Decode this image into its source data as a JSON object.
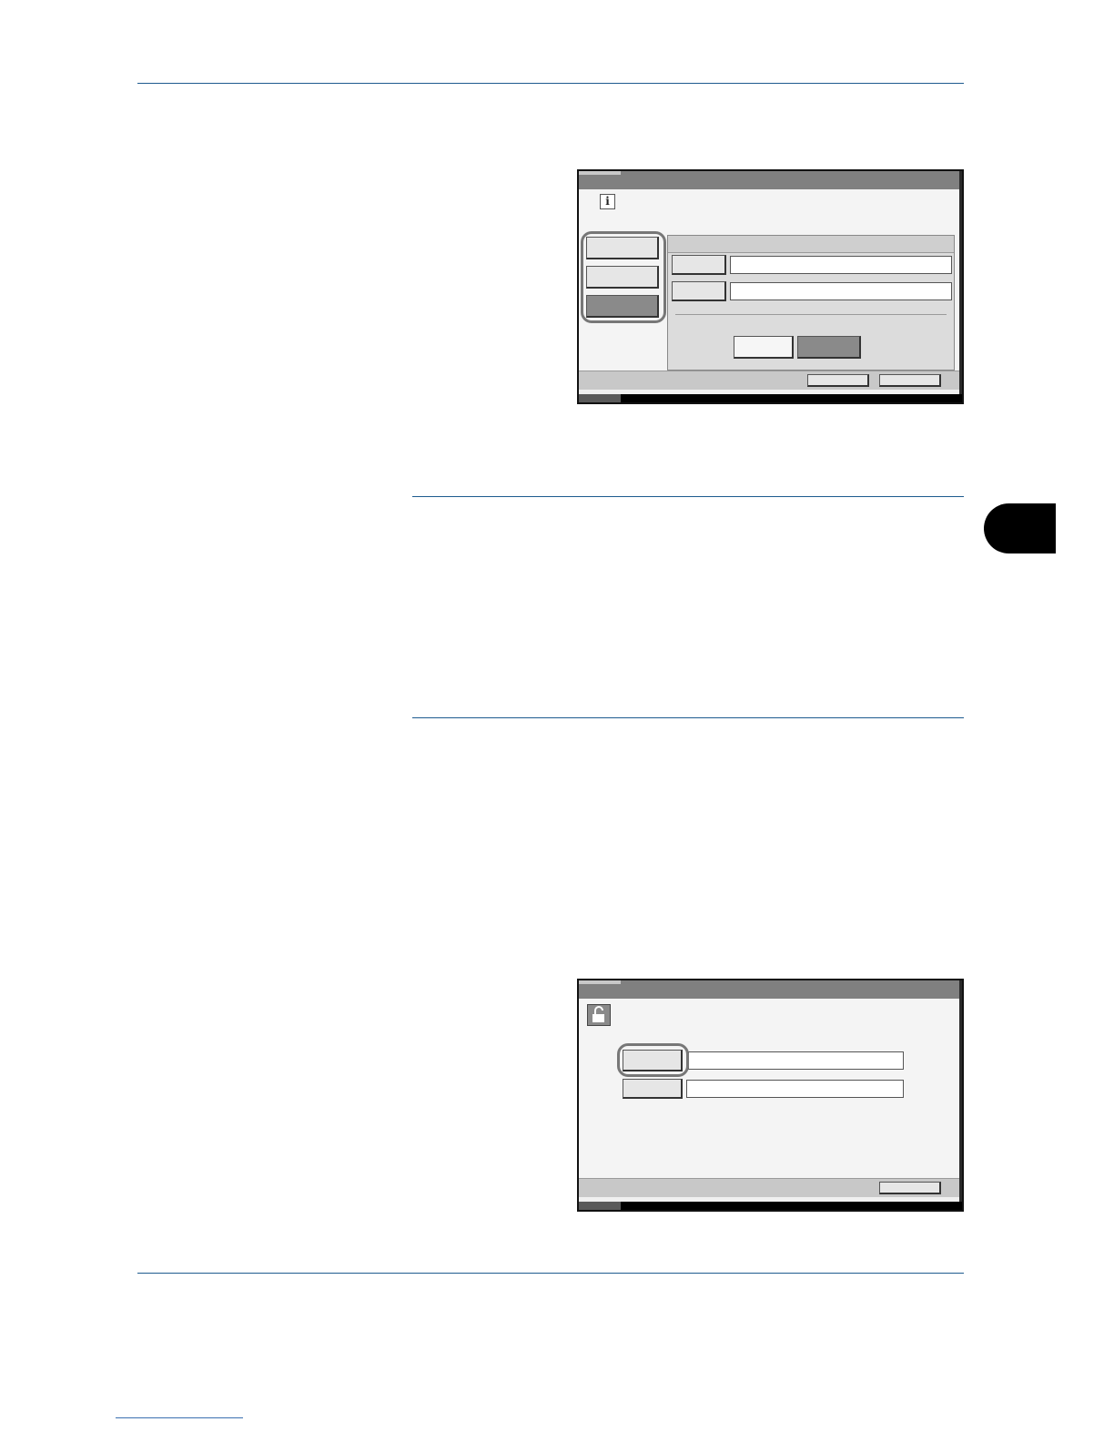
{
  "document": {
    "screens": [
      {
        "info_icon": "info-icon",
        "side_buttons": [
          "",
          "",
          ""
        ],
        "fields": [
          "",
          ""
        ],
        "panel_buttons": [
          "",
          ""
        ],
        "footer_buttons": [
          "",
          ""
        ]
      },
      {
        "lock_icon": "unlock-icon",
        "field_buttons": [
          "",
          ""
        ],
        "fields": [
          "",
          ""
        ],
        "footer_buttons": [
          ""
        ]
      }
    ]
  }
}
